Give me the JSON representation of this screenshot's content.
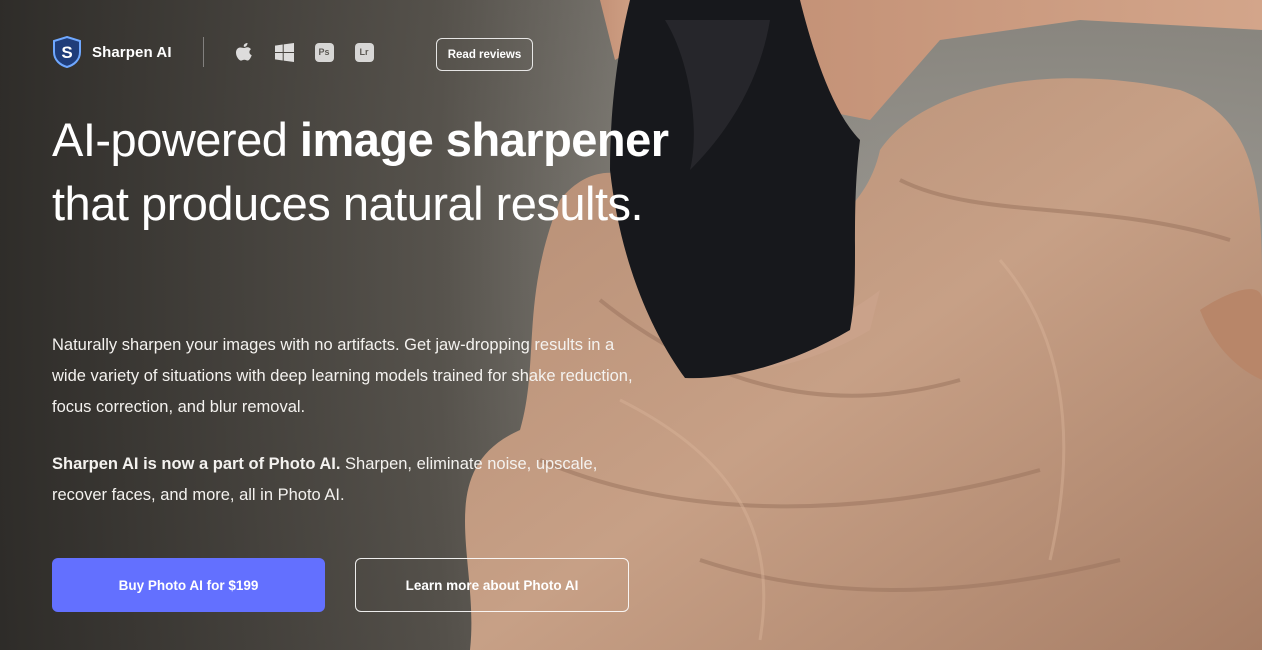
{
  "brand": {
    "name": "Sharpen AI",
    "logo_icon": "shield-s-logo-icon"
  },
  "platforms": [
    {
      "name": "apple-icon"
    },
    {
      "name": "windows-icon"
    },
    {
      "name": "photoshop-icon",
      "label": "Ps"
    },
    {
      "name": "lightroom-icon",
      "label": "Lr"
    }
  ],
  "header": {
    "reviews_label": "Read reviews"
  },
  "hero": {
    "headline_part1": "AI-powered ",
    "headline_bold1": "image sharpener",
    "headline_part2": " that produces natural results.",
    "description": "Naturally sharpen your images with no artifacts. Get jaw-dropping results in a wide variety of situations with deep learning models trained for shake reduction, focus correction, and blur removal.",
    "note_bold": "Sharpen AI is now a part of Photo AI.",
    "note_rest": " Sharpen, eliminate noise, upscale, recover faces, and more, all in Photo AI."
  },
  "cta": {
    "primary_label": "Buy Photo AI for $199",
    "secondary_label": "Learn more about Photo AI"
  },
  "colors": {
    "accent": "#6370ff",
    "background": "#7a7771",
    "skirt": "#c29b82",
    "leotard": "#15161a"
  }
}
